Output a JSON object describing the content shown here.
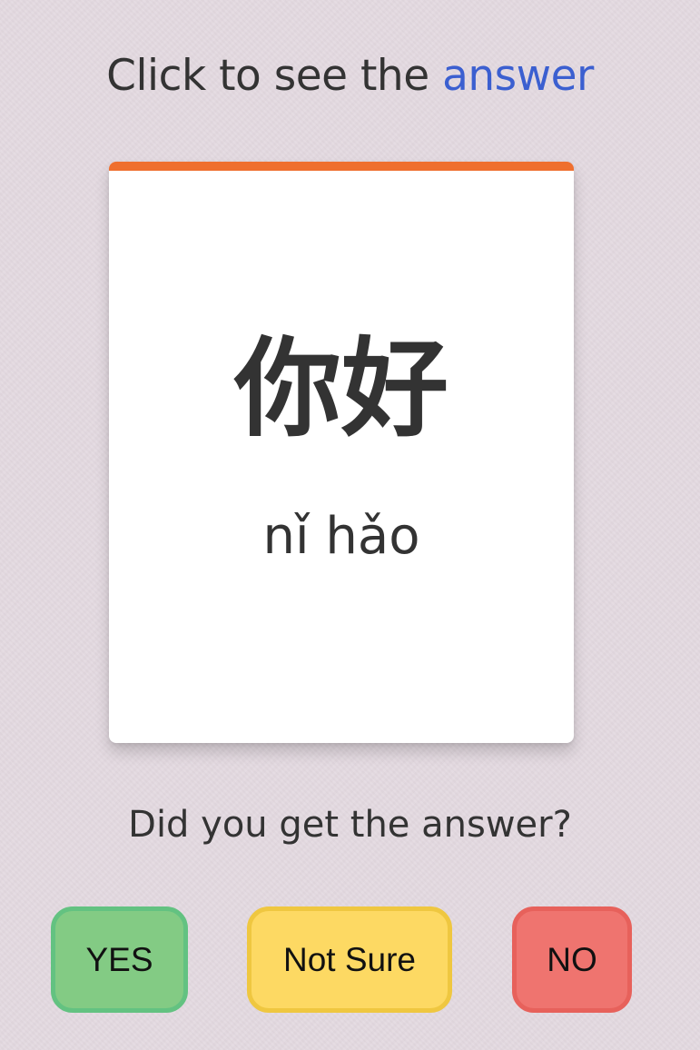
{
  "prompt": {
    "prefix": "Click to see the ",
    "link_text": "answer"
  },
  "card": {
    "characters": "你好",
    "pinyin": "nǐ hǎo"
  },
  "question": "Did you get the answer?",
  "buttons": {
    "yes": "YES",
    "unsure": "Not Sure",
    "no": "NO"
  },
  "colors": {
    "background": "#e3d9e0",
    "card_accent": "#ef6f2e",
    "link": "#3b5fd0",
    "yes": "#83cb84",
    "unsure": "#fdd963",
    "no": "#ef746f"
  }
}
